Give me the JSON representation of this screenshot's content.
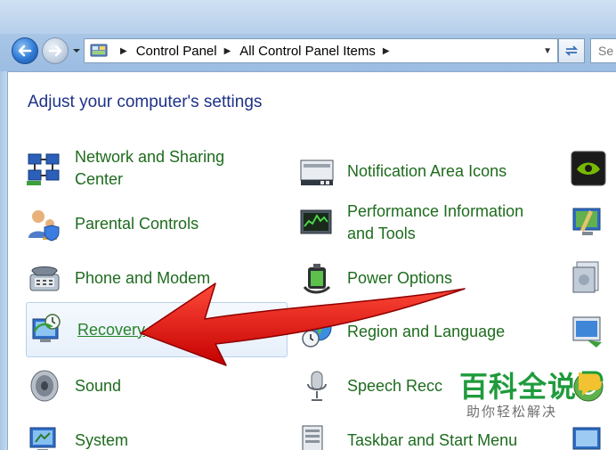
{
  "navigation": {
    "back_icon": "back-arrow-icon",
    "forward_icon": "forward-arrow-icon"
  },
  "address_bar": {
    "icon": "control-panel-icon",
    "crumbs": [
      "Control Panel",
      "All Control Panel Items"
    ]
  },
  "search": {
    "placeholder": "Se"
  },
  "heading": "Adjust your computer's settings",
  "items_left": [
    {
      "label": "Network and Sharing Center",
      "line1": "Network and Sharing",
      "line2": "Center",
      "icon": "network-icon"
    },
    {
      "label": "Parental Controls",
      "icon": "parental-controls-icon"
    },
    {
      "label": "Phone and Modem",
      "icon": "phone-modem-icon"
    },
    {
      "label": "Recovery",
      "icon": "recovery-icon",
      "selected": true
    },
    {
      "label": "Sound",
      "icon": "speaker-icon"
    },
    {
      "label": "System",
      "icon": "system-icon"
    }
  ],
  "items_mid": [
    {
      "label": "Notification Area Icons",
      "icon": "notification-icons-icon"
    },
    {
      "label": "Performance Information and Tools",
      "line1": "Performance Information",
      "line2": "and Tools",
      "icon": "performance-icon"
    },
    {
      "label": "Power Options",
      "icon": "power-options-icon"
    },
    {
      "label": "Region and Language",
      "icon": "globe-clock-icon"
    },
    {
      "label": "Speech Recc",
      "icon": "microphone-icon"
    },
    {
      "label": "Taskbar and Start Menu",
      "icon": "taskbar-icon"
    }
  ],
  "items_right_icons": [
    "nvidia-icon",
    "personalization-icon",
    "programs-icon",
    "remoteapp-icon",
    "sync-icon",
    "monitor-icon"
  ],
  "annotation": {
    "type": "red-arrow",
    "points_to": "Recovery"
  },
  "watermark": {
    "main": "百科全说",
    "sub": "助你轻松解决"
  },
  "colors": {
    "link_green": "#1e6b1e",
    "heading_blue": "#1e3287",
    "arrow_red": "#e01010",
    "watermark_green": "#1f9b3c"
  }
}
